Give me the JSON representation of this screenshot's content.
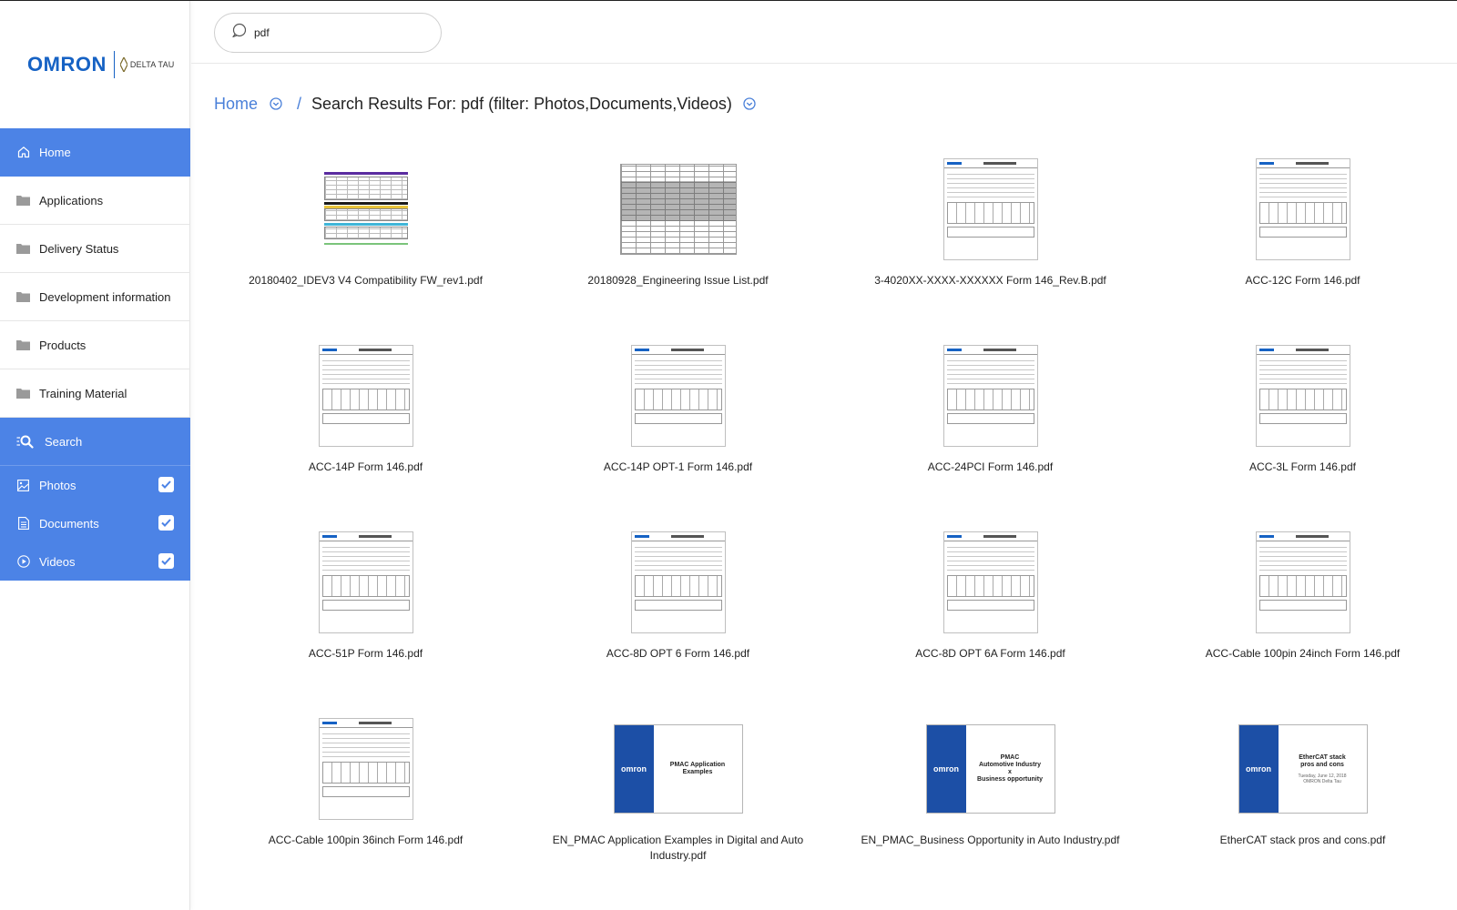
{
  "brand": {
    "name": "OMRON",
    "sub": "DELTA TAU"
  },
  "search": {
    "value": "pdf"
  },
  "breadcrumb": {
    "home": "Home",
    "current": "Search Results For: pdf (filter: Photos,Documents,Videos)"
  },
  "sidebar": {
    "items": [
      {
        "label": "Home",
        "icon": "home-icon"
      },
      {
        "label": "Applications",
        "icon": "folder-icon"
      },
      {
        "label": "Delivery Status",
        "icon": "folder-icon"
      },
      {
        "label": "Development information",
        "icon": "folder-icon"
      },
      {
        "label": "Products",
        "icon": "folder-icon"
      },
      {
        "label": "Training Material",
        "icon": "folder-icon"
      }
    ],
    "search_label": "Search",
    "filters": [
      {
        "label": "Photos",
        "checked": true
      },
      {
        "label": "Documents",
        "checked": true
      },
      {
        "label": "Videos",
        "checked": true
      }
    ]
  },
  "colors": {
    "accent": "#4c83e6",
    "link": "#4a80d9",
    "brand": "#1662c4"
  },
  "files": [
    {
      "name": "20180402_IDEV3 V4 Compatibility FW_rev1.pdf",
      "thumb": "compat"
    },
    {
      "name": "20180928_Engineering Issue List.pdf",
      "thumb": "sheet"
    },
    {
      "name": "3-4020XX-XXXX-XXXXXX Form 146_Rev.B.pdf",
      "thumb": "form"
    },
    {
      "name": "ACC-12C Form 146.pdf",
      "thumb": "form"
    },
    {
      "name": "ACC-14P Form 146.pdf",
      "thumb": "form"
    },
    {
      "name": "ACC-14P OPT-1 Form 146.pdf",
      "thumb": "form"
    },
    {
      "name": "ACC-24PCI Form 146.pdf",
      "thumb": "form"
    },
    {
      "name": "ACC-3L Form 146.pdf",
      "thumb": "form"
    },
    {
      "name": "ACC-51P Form 146.pdf",
      "thumb": "form"
    },
    {
      "name": "ACC-8D OPT 6 Form 146.pdf",
      "thumb": "form"
    },
    {
      "name": "ACC-8D OPT 6A Form 146.pdf",
      "thumb": "form"
    },
    {
      "name": "ACC-Cable 100pin 24inch Form 146.pdf",
      "thumb": "form"
    },
    {
      "name": "ACC-Cable 100pin 36inch Form 146.pdf",
      "thumb": "form"
    },
    {
      "name": "EN_PMAC Application Examples in Digital and Auto Industry.pdf",
      "thumb": "slide",
      "slide_title": "PMAC Application Examples",
      "slide_sub": ""
    },
    {
      "name": "EN_PMAC_Business Opportunity in Auto Industry.pdf",
      "thumb": "slide",
      "slide_title": "PMAC\nAutomotive Industry\nx\nBusiness opportunity",
      "slide_sub": ""
    },
    {
      "name": "EtherCAT stack pros and cons.pdf",
      "thumb": "slide",
      "slide_title": "EtherCAT stack\npros and cons",
      "slide_sub": "Tuesday, June 12, 2018\nOMRON Delta Tau"
    }
  ]
}
